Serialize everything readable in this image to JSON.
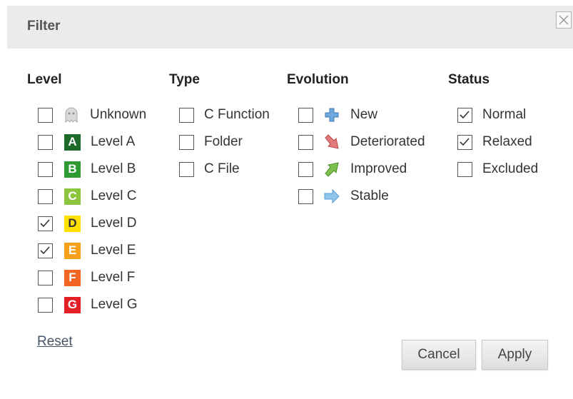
{
  "dialog": {
    "title": "Filter"
  },
  "columns": {
    "level": {
      "header": "Level",
      "options": [
        {
          "label": "Unknown",
          "checked": false,
          "icon": "ghost-icon",
          "letter": "",
          "color": ""
        },
        {
          "label": "Level A",
          "checked": false,
          "icon": "level-a-badge",
          "letter": "A",
          "color": "#1e6b2a"
        },
        {
          "label": "Level B",
          "checked": false,
          "icon": "level-b-badge",
          "letter": "B",
          "color": "#2e9a33"
        },
        {
          "label": "Level C",
          "checked": false,
          "icon": "level-c-badge",
          "letter": "C",
          "color": "#8cc63f"
        },
        {
          "label": "Level D",
          "checked": true,
          "icon": "level-d-badge",
          "letter": "D",
          "color": "#ffe000"
        },
        {
          "label": "Level E",
          "checked": true,
          "icon": "level-e-badge",
          "letter": "E",
          "color": "#f7a11a"
        },
        {
          "label": "Level F",
          "checked": false,
          "icon": "level-f-badge",
          "letter": "F",
          "color": "#f26522"
        },
        {
          "label": "Level G",
          "checked": false,
          "icon": "level-g-badge",
          "letter": "G",
          "color": "#e31e24"
        }
      ]
    },
    "type": {
      "header": "Type",
      "options": [
        {
          "label": "C Function",
          "checked": false
        },
        {
          "label": "Folder",
          "checked": false
        },
        {
          "label": "C File",
          "checked": false
        }
      ]
    },
    "evolution": {
      "header": "Evolution",
      "options": [
        {
          "label": "New",
          "checked": false,
          "icon": "plus-icon"
        },
        {
          "label": "Deteriorated",
          "checked": false,
          "icon": "arrow-down-right-icon"
        },
        {
          "label": "Improved",
          "checked": false,
          "icon": "arrow-up-right-icon"
        },
        {
          "label": "Stable",
          "checked": false,
          "icon": "arrow-right-icon"
        }
      ]
    },
    "status": {
      "header": "Status",
      "options": [
        {
          "label": "Normal",
          "checked": true
        },
        {
          "label": "Relaxed",
          "checked": true
        },
        {
          "label": "Excluded",
          "checked": false
        }
      ]
    }
  },
  "footer": {
    "reset_label": "Reset",
    "cancel_label": "Cancel",
    "apply_label": "Apply"
  },
  "colors": {
    "titlebar_bg": "#ebebeb",
    "evolution_new": "#5b9bd5",
    "evolution_deteriorated": "#e06666",
    "evolution_improved": "#6aa84f",
    "evolution_stable": "#7fb8e0"
  }
}
